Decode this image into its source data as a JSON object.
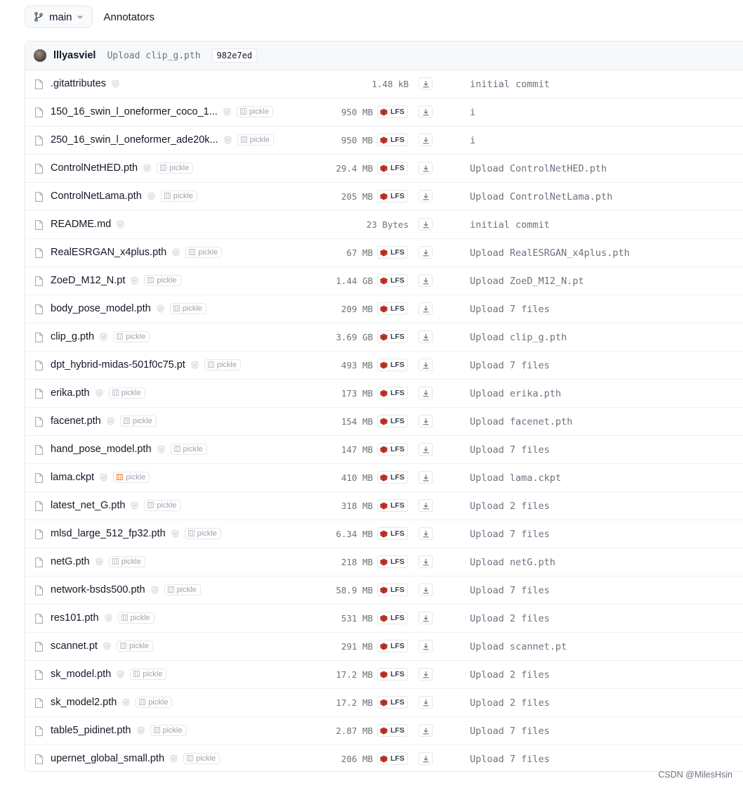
{
  "header": {
    "branch": "main",
    "breadcrumb": "Annotators"
  },
  "commit": {
    "author": "lllyasviel",
    "message": "Upload clip_g.pth",
    "sha": "982e7ed"
  },
  "pickle_label": "pickle",
  "lfs_label": "LFS",
  "colors": {
    "lfs_red": "#c0392b",
    "pickle_orange": "#f97316"
  },
  "files": [
    {
      "name": ".gitattributes",
      "size": "1.48 kB",
      "lfs": false,
      "pickle": false,
      "commit": "initial commit"
    },
    {
      "name": "150_16_swin_l_oneformer_coco_1...",
      "size": "950 MB",
      "lfs": true,
      "pickle": true,
      "commit": "i"
    },
    {
      "name": "250_16_swin_l_oneformer_ade20k...",
      "size": "950 MB",
      "lfs": true,
      "pickle": true,
      "commit": "i"
    },
    {
      "name": "ControlNetHED.pth",
      "size": "29.4 MB",
      "lfs": true,
      "pickle": true,
      "commit": "Upload ControlNetHED.pth"
    },
    {
      "name": "ControlNetLama.pth",
      "size": "205 MB",
      "lfs": true,
      "pickle": true,
      "commit": "Upload ControlNetLama.pth"
    },
    {
      "name": "README.md",
      "size": "23 Bytes",
      "lfs": false,
      "pickle": false,
      "commit": "initial commit"
    },
    {
      "name": "RealESRGAN_x4plus.pth",
      "size": "67 MB",
      "lfs": true,
      "pickle": true,
      "commit": "Upload RealESRGAN_x4plus.pth"
    },
    {
      "name": "ZoeD_M12_N.pt",
      "size": "1.44 GB",
      "lfs": true,
      "pickle": true,
      "commit": "Upload ZoeD_M12_N.pt"
    },
    {
      "name": "body_pose_model.pth",
      "size": "209 MB",
      "lfs": true,
      "pickle": true,
      "commit": "Upload 7 files"
    },
    {
      "name": "clip_g.pth",
      "size": "3.69 GB",
      "lfs": true,
      "pickle": true,
      "commit": "Upload clip_g.pth"
    },
    {
      "name": "dpt_hybrid-midas-501f0c75.pt",
      "size": "493 MB",
      "lfs": true,
      "pickle": true,
      "commit": "Upload 7 files"
    },
    {
      "name": "erika.pth",
      "size": "173 MB",
      "lfs": true,
      "pickle": true,
      "commit": "Upload erika.pth"
    },
    {
      "name": "facenet.pth",
      "size": "154 MB",
      "lfs": true,
      "pickle": true,
      "commit": "Upload facenet.pth"
    },
    {
      "name": "hand_pose_model.pth",
      "size": "147 MB",
      "lfs": true,
      "pickle": true,
      "commit": "Upload 7 files"
    },
    {
      "name": "lama.ckpt",
      "size": "410 MB",
      "lfs": true,
      "pickle": true,
      "pickle_warn": true,
      "commit": "Upload lama.ckpt"
    },
    {
      "name": "latest_net_G.pth",
      "size": "318 MB",
      "lfs": true,
      "pickle": true,
      "commit": "Upload 2 files"
    },
    {
      "name": "mlsd_large_512_fp32.pth",
      "size": "6.34 MB",
      "lfs": true,
      "pickle": true,
      "commit": "Upload 7 files"
    },
    {
      "name": "netG.pth",
      "size": "218 MB",
      "lfs": true,
      "pickle": true,
      "commit": "Upload netG.pth"
    },
    {
      "name": "network-bsds500.pth",
      "size": "58.9 MB",
      "lfs": true,
      "pickle": true,
      "commit": "Upload 7 files"
    },
    {
      "name": "res101.pth",
      "size": "531 MB",
      "lfs": true,
      "pickle": true,
      "commit": "Upload 2 files"
    },
    {
      "name": "scannet.pt",
      "size": "291 MB",
      "lfs": true,
      "pickle": true,
      "commit": "Upload scannet.pt"
    },
    {
      "name": "sk_model.pth",
      "size": "17.2 MB",
      "lfs": true,
      "pickle": true,
      "commit": "Upload 2 files"
    },
    {
      "name": "sk_model2.pth",
      "size": "17.2 MB",
      "lfs": true,
      "pickle": true,
      "commit": "Upload 2 files"
    },
    {
      "name": "table5_pidinet.pth",
      "size": "2.87 MB",
      "lfs": true,
      "pickle": true,
      "commit": "Upload 7 files"
    },
    {
      "name": "upernet_global_small.pth",
      "size": "206 MB",
      "lfs": true,
      "pickle": true,
      "commit": "Upload 7 files"
    }
  ],
  "watermark": "CSDN @MilesHsin"
}
